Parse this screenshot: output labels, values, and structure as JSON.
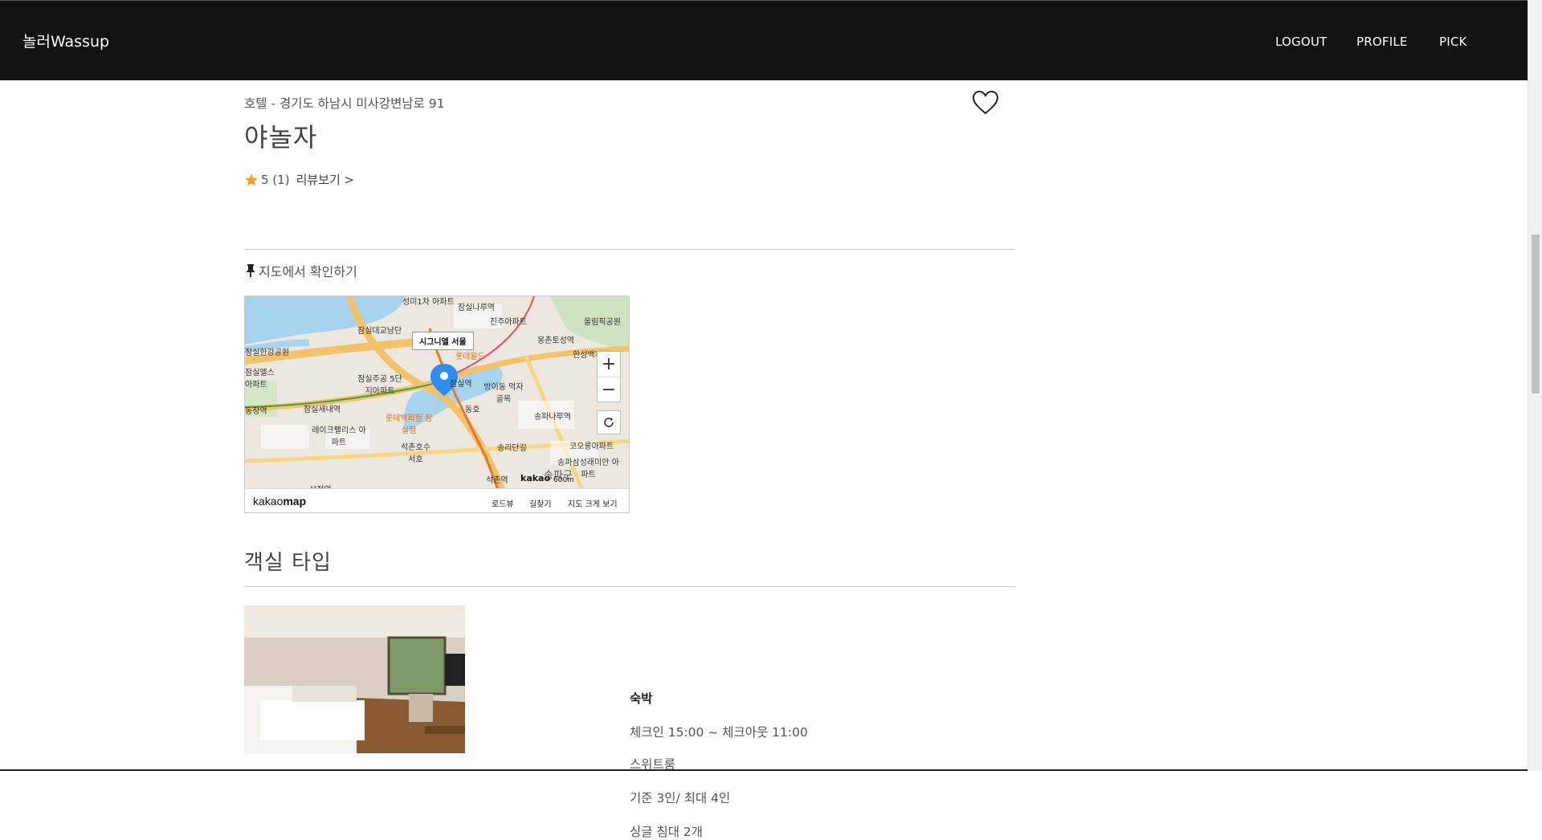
{
  "nav": {
    "brand": "놀러Wassup",
    "links": [
      "LOGOUT",
      "PROFILE",
      "PICK"
    ]
  },
  "listing": {
    "category_address": "호텔 - 경기도 하남시 미사강변남로 91",
    "title": "야놀자",
    "rating": "5 (1)",
    "review_link": "리뷰보기 >"
  },
  "map": {
    "heading": "지도에서 확인하기",
    "marker_label": "시그니엘 서울",
    "logo_prefix": "kakao",
    "logo_suffix": "map",
    "footer_links": [
      "로드뷰",
      "길찾기",
      "지도 크게 보기"
    ],
    "labels": [
      "성미1차 아파트",
      "잠실나루역",
      "잠실대교남단",
      "진주아파트",
      "올림픽공원",
      "잠실한강공원",
      "몽촌토성역",
      "한성백제역",
      "롯데월드",
      "잠실주공 5단지아파트",
      "잠실엘스 아파트",
      "잠실역",
      "방이동 먹자골목",
      "동장역",
      "잠실새내역",
      "동호",
      "롯데백화점 잠실점",
      "송파나루역",
      "레이크팰리스 아파트",
      "석촌호수 서호",
      "송리단길",
      "코오롱아파트",
      "송파삼성래미안 아파트",
      "석촌역",
      "삼전역",
      "송파구"
    ],
    "kakao_mark": "kakao",
    "scale": "600m",
    "zoom_in": "+",
    "zoom_out": "−"
  },
  "rooms": {
    "heading": "객실 타입",
    "items": [
      {
        "type": "숙박",
        "checkin": "체크인 15:00 ~ 체크아웃 11:00",
        "name": "스위트룸",
        "capacity": "기준 3인/ 최대 4인",
        "bed": "싱글 침대 2개"
      }
    ]
  },
  "colors": {
    "navbar": "#121212",
    "star": "#f5a623",
    "marker": "#2b8ef0"
  },
  "icons": [
    "heart-icon",
    "star-icon",
    "pushpin-icon",
    "zoom-in-icon",
    "zoom-out-icon",
    "refresh-icon",
    "map-marker-icon"
  ]
}
